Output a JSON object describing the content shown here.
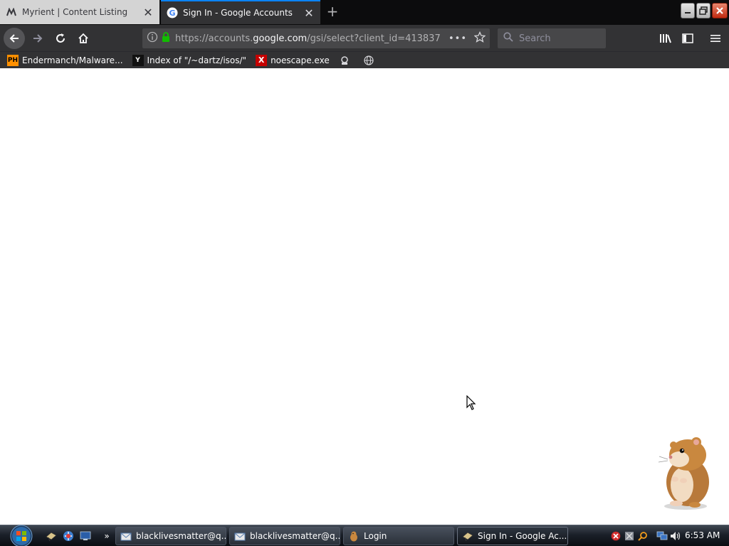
{
  "tabs": [
    {
      "title": "Myrient | Content Listing",
      "favicon": "myrient-icon",
      "active": false
    },
    {
      "title": "Sign In - Google Accounts",
      "favicon": "google-g-icon",
      "active": true
    }
  ],
  "navbar": {
    "url_prefix": "https://accounts.",
    "url_domain": "google.com",
    "url_path": "/gsi/select?client_id=413837",
    "page_actions": "•••",
    "search_placeholder": "Search"
  },
  "bookmarks": [
    {
      "label": "Endermanch/Malware...",
      "favicon_text": "PH"
    },
    {
      "label": "Index of \"/~dartz/isos/\"",
      "favicon_text": "Y"
    },
    {
      "label": "noescape.exe",
      "favicon_text": "X"
    },
    {
      "label": "",
      "favicon_text": ""
    },
    {
      "label": "",
      "favicon_text": ""
    }
  ],
  "taskbar": {
    "buttons": [
      {
        "label": "blacklivesmatter@q...",
        "active": false
      },
      {
        "label": "blacklivesmatter@q...",
        "active": false
      },
      {
        "label": "Login",
        "active": false
      },
      {
        "label": "Sign In - Google Ac...",
        "active": true
      }
    ],
    "quicklaunch_more": "»",
    "clock": "6:53 AM"
  },
  "colors": {
    "tab_active_accent": "#0a84ff",
    "lock_green": "#12bc00",
    "toolbar": "#323234",
    "taskbar": "#1b2029"
  }
}
